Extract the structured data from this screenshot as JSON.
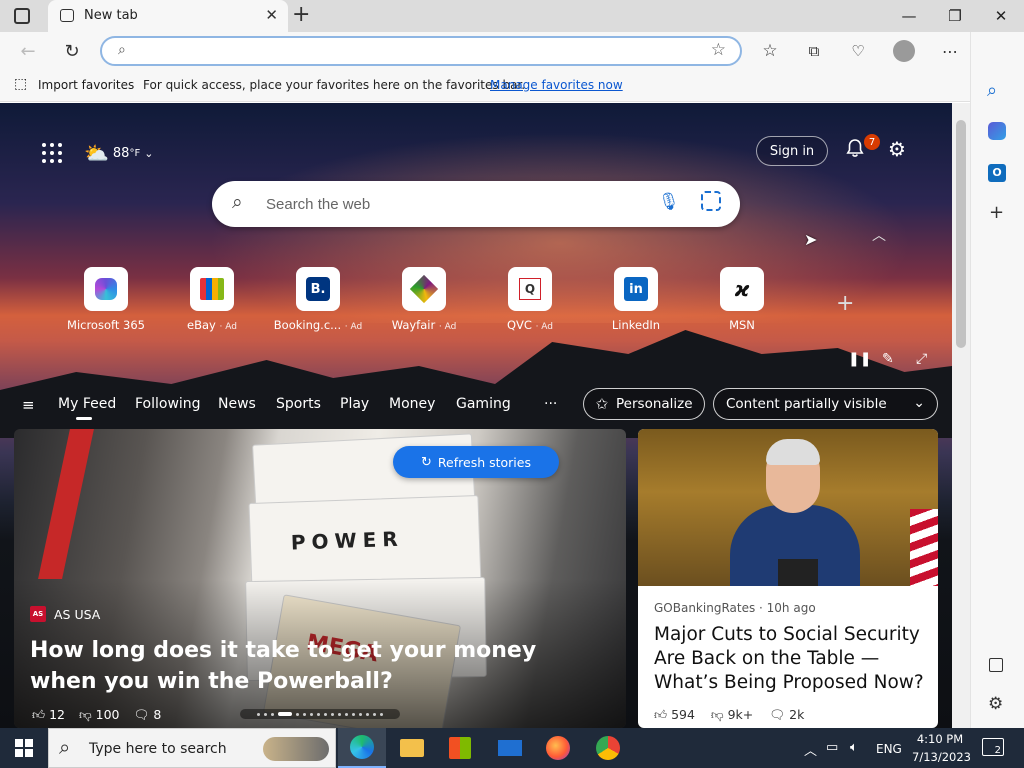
{
  "browser": {
    "tab_title": "New tab",
    "address_value": "",
    "fav_bar": {
      "import_label": "Import favorites",
      "message": "For quick access, place your favorites here on the favorites bar.",
      "manage_link": "Manage favorites now"
    }
  },
  "newtab": {
    "weather": {
      "temp": "88",
      "unit": "°F"
    },
    "sign_in_label": "Sign in",
    "notification_count": "7",
    "search_placeholder": "Search the web",
    "quick_links": [
      {
        "label": "Microsoft 365",
        "ad": ""
      },
      {
        "label": "eBay",
        "ad": "· Ad"
      },
      {
        "label": "Booking.c...",
        "ad": "· Ad"
      },
      {
        "label": "Wayfair",
        "ad": "· Ad"
      },
      {
        "label": "QVC",
        "ad": "· Ad"
      },
      {
        "label": "LinkedIn",
        "ad": ""
      },
      {
        "label": "MSN",
        "ad": ""
      }
    ],
    "nav": [
      "My Feed",
      "Following",
      "News",
      "Sports",
      "Play",
      "Money",
      "Gaming"
    ],
    "more_label": "···",
    "personalize_label": "Personalize",
    "content_visibility": "Content partially visible",
    "refresh_label": "Refresh stories"
  },
  "cards": [
    {
      "source": "AS USA",
      "title": "How long does it take to get your money when you win the Powerball?",
      "likes": "12",
      "dislikes": "100",
      "comments": "8"
    },
    {
      "source": "GOBankingRates · 10h ago",
      "title": "Major Cuts to Social Security Are Back on the Table — What’s Being Proposed Now?",
      "likes": "594",
      "dislikes": "9k+",
      "comments": "2k"
    }
  ],
  "taskbar": {
    "search_placeholder": "Type here to search",
    "language": "ENG",
    "time": "4:10 PM",
    "date": "7/13/2023",
    "notifications": "2"
  },
  "colors": {
    "accent": "#1a73e8",
    "badge": "#d83b01",
    "taskbar": "#1f2a3a"
  }
}
